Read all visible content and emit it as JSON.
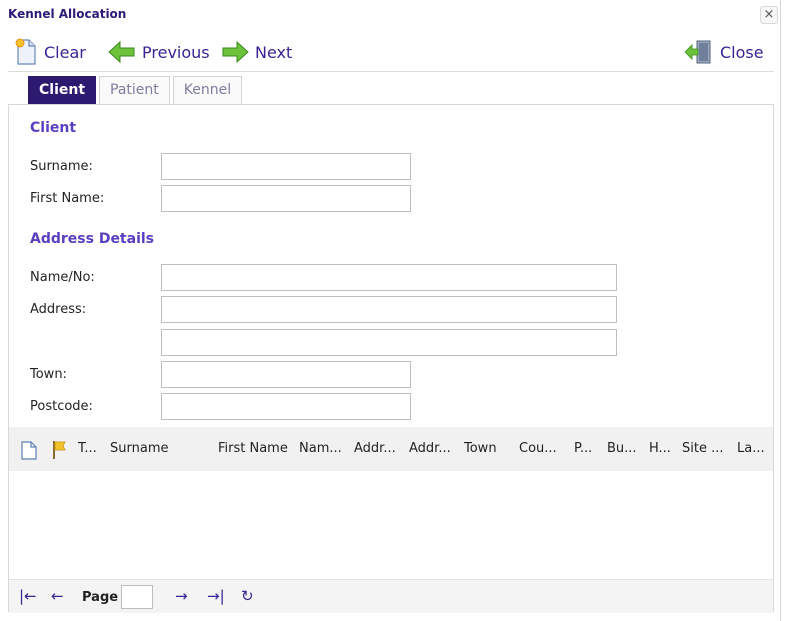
{
  "window": {
    "title": "Kennel Allocation",
    "close_glyph": "×"
  },
  "toolbar": {
    "clear": "Clear",
    "previous": "Previous",
    "next": "Next",
    "close": "Close"
  },
  "tabs": [
    "Client",
    "Patient",
    "Kennel"
  ],
  "client_section": {
    "title": "Client",
    "surname_label": "Surname:",
    "first_name_label": "First Name:"
  },
  "address_section": {
    "title": "Address Details",
    "name_no_label": "Name/No:",
    "address_label": "Address:",
    "town_label": "Town:",
    "postcode_label": "Postcode:"
  },
  "grid": {
    "columns": [
      "T...",
      "Surname",
      "First Name",
      "Nam...",
      "Addr...",
      "Addr...",
      "Town",
      "Cou...",
      "P...",
      "Bu...",
      "H...",
      "Site ...",
      "La..."
    ]
  },
  "pager": {
    "first": "|←",
    "prev": "←",
    "page_label": "Page",
    "next": "→",
    "last": "→|",
    "refresh": "↻"
  },
  "colors": {
    "accent": "#3a2393",
    "tab_active": "#2b1a6f",
    "section": "#5a3fc0"
  }
}
